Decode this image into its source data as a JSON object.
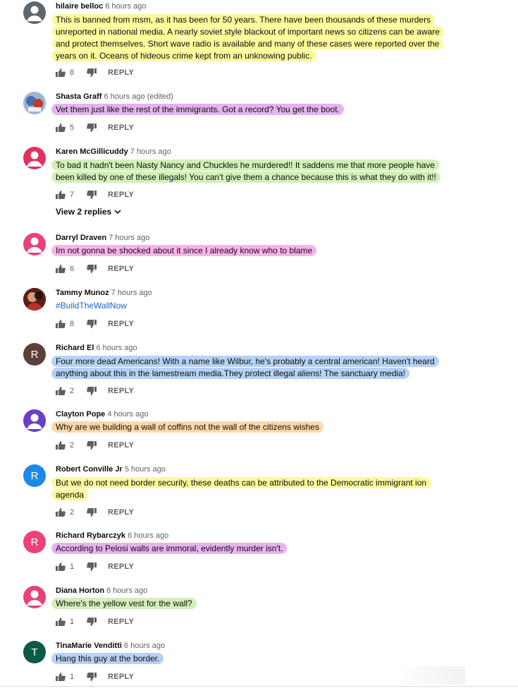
{
  "comments": [
    {
      "author": "hilaire belloc",
      "time": "6 hours ago",
      "lines": [
        "This is banned from msm, as it has been for 50 years. There have been thousands of these murders",
        "unreported in national media. A nearly soviet style blackout of important news so citizens can be aware",
        "and protect themselves. Short wave radio is available and many of these cases were reported over the",
        "years on it. Oceans of hideous crime kept from an unknowing public."
      ],
      "likes": "8",
      "reply": "REPLY",
      "avatar_color": "#5f6670",
      "highlight": "#fdf99a"
    },
    {
      "author": "Shasta Graff",
      "time": "6 hours ago (edited)",
      "lines": [
        "Vet them just like the rest of the immigrants.  Got a record?  You get the boot."
      ],
      "likes": "5",
      "reply": "REPLY",
      "avatar_color": "#3e6fb0",
      "highlight": "#e3b4ee"
    },
    {
      "author": "Karen McGillicuddy",
      "time": "7 hours ago",
      "lines": [
        "To bad it hadn't been Nasty Nancy and Chuckles he murdered!!  It saddens me that more people have",
        "been killed by one of these illegals!  You can't give them a chance because this is what they do with it!!"
      ],
      "likes": "7",
      "reply": "REPLY",
      "avatar_color": "#e0315f",
      "highlight": "#d3f0b9"
    },
    {
      "author": "Darryl Draven",
      "time": "7 hours ago",
      "lines": [
        "Im not gonna be shocked about it since I already know who to blame"
      ],
      "likes": "6",
      "reply": "REPLY",
      "avatar_color": "#ec407a",
      "highlight": "#fbb3ea"
    },
    {
      "author": "Tammy Munoz",
      "time": "7 hours ago",
      "lines": [
        "#BuildTheWallNow"
      ],
      "likes": "8",
      "reply": "REPLY",
      "avatar_color": "#7a2a22",
      "highlight": ""
    },
    {
      "author": "Richard El",
      "time": "6 hours ago",
      "avatar_letter": "R",
      "lines": [
        "Four more dead Americans! With a name like Wilbur, he's probably a central american! Haven't heard",
        "anything about this in the lamestream media.They protect illegal aliens! The sanctuary media!"
      ],
      "likes": "2",
      "reply": "REPLY",
      "avatar_color": "#5d4037",
      "highlight": "#b6d2f6"
    },
    {
      "author": "Clayton Pope",
      "time": "4 hours ago",
      "lines": [
        "Why are we building a wall of coffins not the wall of the citizens wishes"
      ],
      "likes": "2",
      "reply": "REPLY",
      "avatar_color": "#6a3fc4",
      "highlight": "#fcd8a8"
    },
    {
      "author": "Robert Conville Jr",
      "time": "5 hours ago",
      "avatar_letter": "R",
      "lines": [
        "But we do not need border security, these deaths can be attributed to the Democratic immigrant ion",
        "agenda"
      ],
      "likes": "2",
      "reply": "REPLY",
      "avatar_color": "#1e88e5",
      "highlight": "#fdf99a"
    },
    {
      "author": "Richard Rybarczyk",
      "time": "6 hours ago",
      "avatar_letter": "R",
      "lines": [
        "According to Pelosi walls are immoral, evidently murder isn't."
      ],
      "likes": "1",
      "reply": "REPLY",
      "avatar_color": "#ec407a",
      "highlight": "#e3b4ee"
    },
    {
      "author": "Diana Horton",
      "time": "6 hours ago",
      "lines": [
        "Where's the yellow vest for the wall?"
      ],
      "likes": "1",
      "reply": "REPLY",
      "avatar_color": "#ec407a",
      "highlight": "#d3f0b9"
    },
    {
      "author": "TinaMarie Venditti",
      "time": "6 hours ago",
      "avatar_letter": "T",
      "lines": [
        "Hang this guy at the border."
      ],
      "likes": "1",
      "reply": "REPLY",
      "avatar_color": "#0b5a45",
      "highlight": "#b6d2f6"
    }
  ],
  "view_replies": "View 2 replies",
  "icons": {
    "like": "thumbs-up-icon",
    "dislike": "thumbs-down-icon",
    "expand": "chevron-down-icon",
    "default_avatar": "person-icon"
  }
}
